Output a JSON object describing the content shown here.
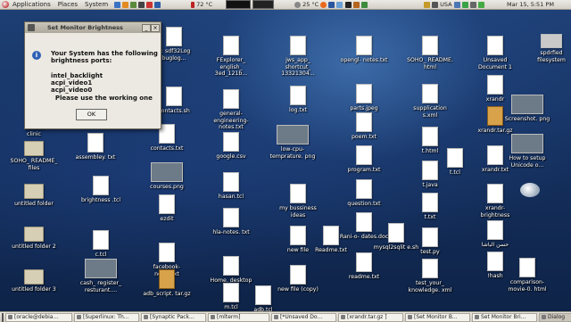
{
  "topbar": {
    "menus": [
      "Applications",
      "Places",
      "System"
    ],
    "cpu_temp": "72 °C",
    "weather_temp": "25 °C",
    "layout": "USA",
    "datetime": "Mar 15, 5:51 PM"
  },
  "dialog": {
    "title": "Set Monitor Brightness",
    "message": [
      "Your System has the following",
      "brightness ports:",
      "",
      "intel_backlight",
      "acpi_video1",
      "acpi_video0",
      "  Please use the working one"
    ],
    "ok_label": "OK"
  },
  "desktop_icons": [
    {
      "label": "clinic",
      "kind": "folder"
    },
    {
      "label": "SOHO_ README_ files",
      "kind": "folder"
    },
    {
      "label": "untitled folder",
      "kind": "folder"
    },
    {
      "label": "untitled folder 2",
      "kind": "folder"
    },
    {
      "label": "untitled folder 3",
      "kind": "folder"
    },
    {
      "label": "C: sdf32Log buglog...",
      "kind": "file"
    },
    {
      "label": "contacts.sh",
      "kind": "file"
    },
    {
      "label": "assembley. txt",
      "kind": "file"
    },
    {
      "label": "contacts.txt",
      "kind": "file"
    },
    {
      "label": "courses.png",
      "kind": "image"
    },
    {
      "label": "brightness .tcl",
      "kind": "file"
    },
    {
      "label": "ezdit",
      "kind": "file"
    },
    {
      "label": "c.tcl",
      "kind": "file"
    },
    {
      "label": "facebook- notes.txt",
      "kind": "file"
    },
    {
      "label": "cash_ register_ resturant....",
      "kind": "image"
    },
    {
      "label": "adb_script. tar.gz",
      "kind": "archive"
    },
    {
      "label": "FExplorer_ english_ 3ed_121b...",
      "kind": "file"
    },
    {
      "label": "general- engineering- notes.txt",
      "kind": "file"
    },
    {
      "label": "google.csv",
      "kind": "file"
    },
    {
      "label": "hasan.tcl",
      "kind": "file"
    },
    {
      "label": "hla-notes. txt",
      "kind": "file"
    },
    {
      "label": "Home. desktop",
      "kind": "file"
    },
    {
      "label": "m.tcl",
      "kind": "file"
    },
    {
      "label": "jws_app_ shortcut_ 13321304...",
      "kind": "file"
    },
    {
      "label": "log.txt",
      "kind": "file"
    },
    {
      "label": "low-cpu- temprature. png",
      "kind": "image"
    },
    {
      "label": "my bussiness ideas",
      "kind": "file"
    },
    {
      "label": "new file",
      "kind": "file"
    },
    {
      "label": "new file (copy)",
      "kind": "file"
    },
    {
      "label": "adb.tcl",
      "kind": "file"
    },
    {
      "label": "Readme.txt",
      "kind": "file"
    },
    {
      "label": "opengl- notes.txt",
      "kind": "file"
    },
    {
      "label": "parts.jpeg",
      "kind": "file"
    },
    {
      "label": "poem.txt",
      "kind": "file"
    },
    {
      "label": "program.txt",
      "kind": "file"
    },
    {
      "label": "question.txt",
      "kind": "file"
    },
    {
      "label": "Rani-o- dates.doc",
      "kind": "file"
    },
    {
      "label": "readme.txt",
      "kind": "file"
    },
    {
      "label": "mysql2sqlit e.sh",
      "kind": "file"
    },
    {
      "label": "SOHO_ README. html",
      "kind": "file"
    },
    {
      "label": "supplication s.xml",
      "kind": "file"
    },
    {
      "label": "t.html",
      "kind": "file"
    },
    {
      "label": "t.java",
      "kind": "file"
    },
    {
      "label": "t.tcl",
      "kind": "file"
    },
    {
      "label": "t.txt",
      "kind": "file"
    },
    {
      "label": "test.py",
      "kind": "file"
    },
    {
      "label": "test_your_ knowledge. xml",
      "kind": "file"
    },
    {
      "label": "Unsaved Document 1",
      "kind": "file"
    },
    {
      "label": "xrandr",
      "kind": "file"
    },
    {
      "label": "xrandr.tar.gz",
      "kind": "archive"
    },
    {
      "label": "xrandr.txt",
      "kind": "file"
    },
    {
      "label": "xrandr- brightness",
      "kind": "file"
    },
    {
      "label": "حسن الباشا",
      "kind": "file"
    },
    {
      "label": "!hash",
      "kind": "file"
    },
    {
      "label": "spdrfied filesystem",
      "kind": "device"
    },
    {
      "label": "Screenshot. png",
      "kind": "image"
    },
    {
      "label": "How to setup Unicode o...",
      "kind": "image"
    },
    {
      "label": "comparison- movie-0. html",
      "kind": "file"
    }
  ],
  "taskbar": [
    {
      "label": "[oracle@debia...",
      "active": false
    },
    {
      "label": "[Superlinux: Th...",
      "active": false
    },
    {
      "label": "[Synaptic Pack...",
      "active": false
    },
    {
      "label": "[mlterm]",
      "active": false
    },
    {
      "label": "[*Unsaved Do...",
      "active": false
    },
    {
      "label": "[xrandr.tar.gz ]",
      "active": false
    },
    {
      "label": "[Set Monitor B...",
      "active": false
    },
    {
      "label": "Set Monitor Bri...",
      "active": false
    },
    {
      "label": "Dialog",
      "active": true
    }
  ]
}
